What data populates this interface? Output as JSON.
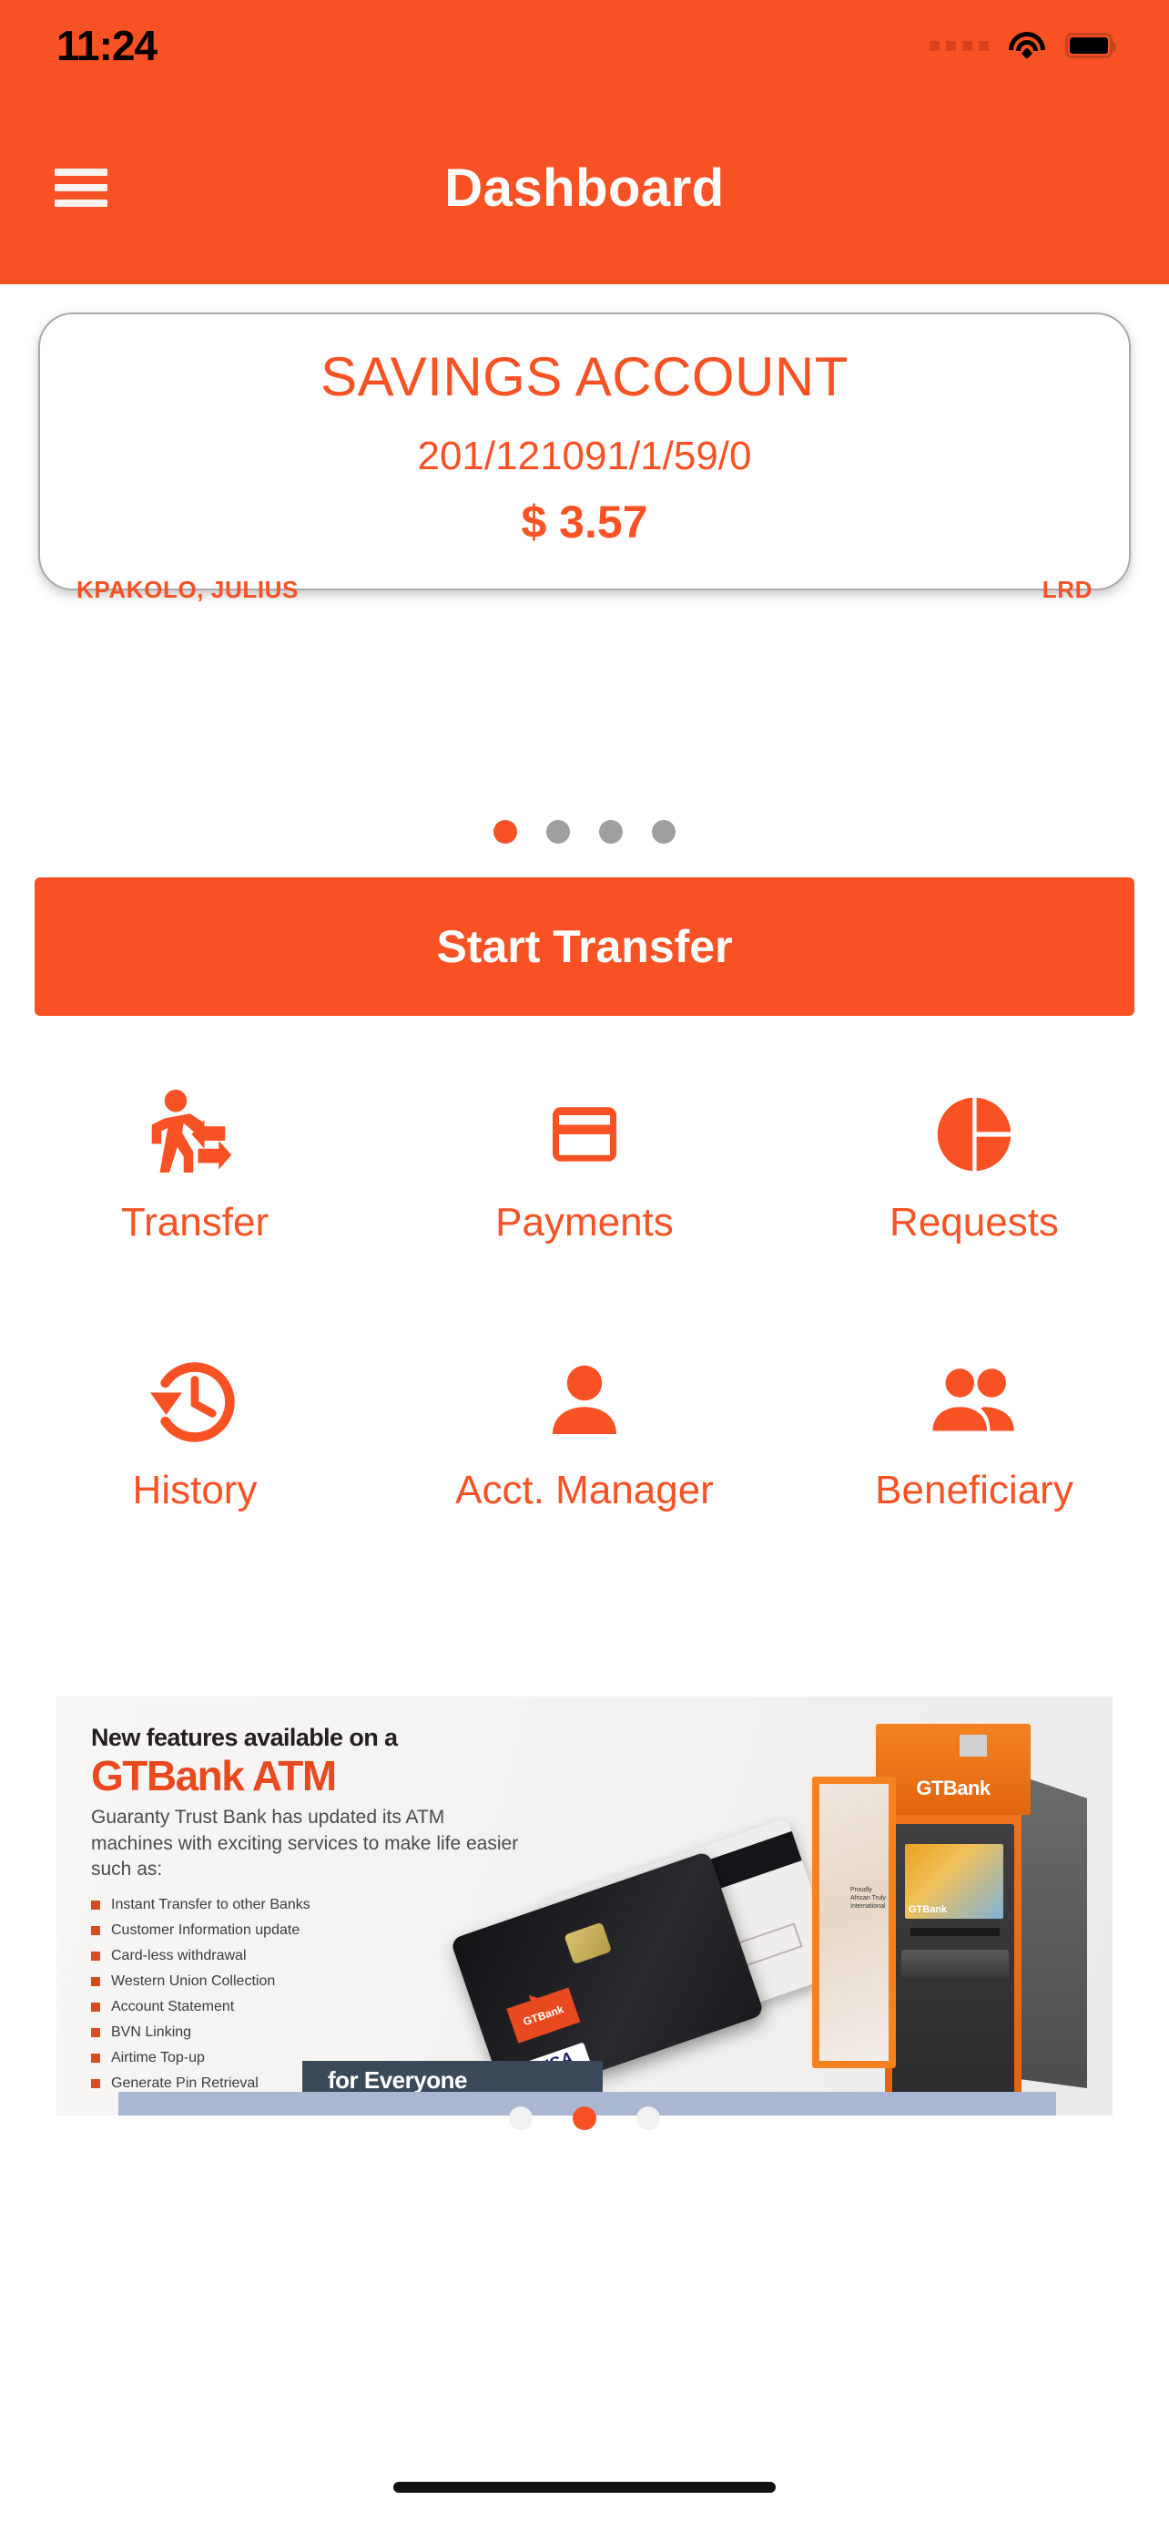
{
  "status_bar": {
    "time": "11:24",
    "signal_icon": "signal-dots-icon",
    "wifi_icon": "wifi-icon",
    "battery_icon": "battery-full-icon"
  },
  "nav": {
    "menu_icon": "hamburger-menu-icon",
    "title": "Dashboard"
  },
  "account_card": {
    "type": "SAVINGS ACCOUNT",
    "number": "201/121091/1/59/0",
    "balance": "$ 3.57",
    "holder": "KPAKOLO, JULIUS",
    "currency": "LRD"
  },
  "card_carousel": {
    "count": 4,
    "active_index": 0
  },
  "cta": {
    "label": "Start Transfer"
  },
  "quick_actions": [
    {
      "label": "Transfer",
      "icon": "person-transfer-arrows-icon"
    },
    {
      "label": "Payments",
      "icon": "credit-card-icon"
    },
    {
      "label": "Requests",
      "icon": "pie-circle-icon"
    },
    {
      "label": "History",
      "icon": "clock-rotate-left-icon"
    },
    {
      "label": "Acct. Manager",
      "icon": "person-icon"
    },
    {
      "label": "Beneficiary",
      "icon": "people-group-icon"
    }
  ],
  "promo": {
    "headline_small": "New features available on a",
    "headline_big": "GTBank ATM",
    "subtitle": "Guaranty Trust Bank has updated its ATM machines with exciting services to make life easier such as:",
    "features": [
      "Instant Transfer to other Banks",
      "Customer Information update",
      "Card-less withdrawal",
      "Western Union Collection",
      "Account Statement",
      "BVN Linking",
      "Airtime Top-up",
      "Generate Pin Retrieval"
    ],
    "atm_brand": "GTBank",
    "atm_screen_brand": "GTBank",
    "card_brand": "GTBank",
    "card_network": "VISA",
    "atm_door_text": "Proudly African Truly International",
    "overlay_label": "for Everyone"
  },
  "promo_carousel": {
    "count": 3,
    "active_index": 1
  },
  "colors": {
    "brand_orange": "#F75124",
    "promo_orange": "#E8491E",
    "dot_inactive": "#9e9e9e"
  }
}
